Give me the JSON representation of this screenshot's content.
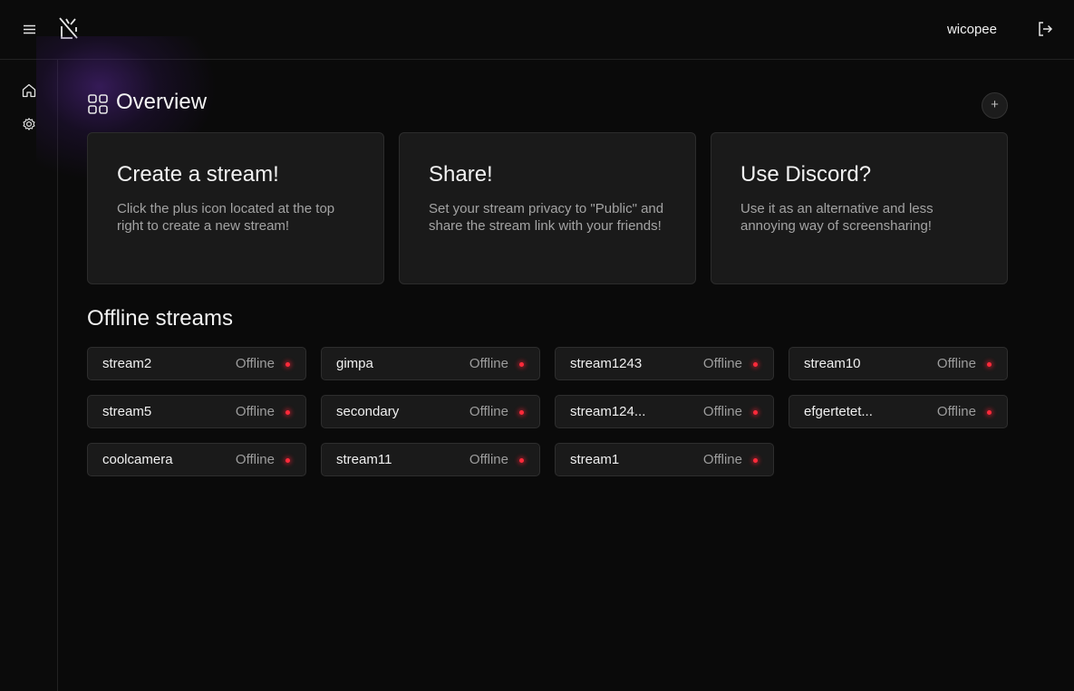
{
  "header": {
    "username": "wicopee"
  },
  "overview": {
    "title": "Overview",
    "add_label": "+",
    "cards": [
      {
        "title": "Create a stream!",
        "text": "Click the plus icon located at the top right to create a new stream!"
      },
      {
        "title": "Share!",
        "text": "Set your stream privacy to \"Public\" and share the stream link with your friends!"
      },
      {
        "title": "Use Discord?",
        "text": "Use it as an alternative and less annoying way of screensharing!"
      }
    ]
  },
  "offline": {
    "title": "Offline streams",
    "streams": [
      {
        "name": "stream2",
        "status": "Offline"
      },
      {
        "name": "gimpa",
        "status": "Offline"
      },
      {
        "name": "stream1243",
        "status": "Offline"
      },
      {
        "name": "stream10",
        "status": "Offline"
      },
      {
        "name": "stream5",
        "status": "Offline"
      },
      {
        "name": "secondary",
        "status": "Offline"
      },
      {
        "name": "stream124...",
        "status": "Offline"
      },
      {
        "name": "efgertetet...",
        "status": "Offline"
      },
      {
        "name": "coolcamera",
        "status": "Offline"
      },
      {
        "name": "stream11",
        "status": "Offline"
      },
      {
        "name": "stream1",
        "status": "Offline"
      }
    ],
    "status_color": "#ff2a3a"
  },
  "icons": {
    "menu": "menu-icon",
    "logo": "logo-icon",
    "logout": "logout-icon",
    "home": "home-icon",
    "settings": "gear-icon",
    "overview": "grid-icon"
  }
}
